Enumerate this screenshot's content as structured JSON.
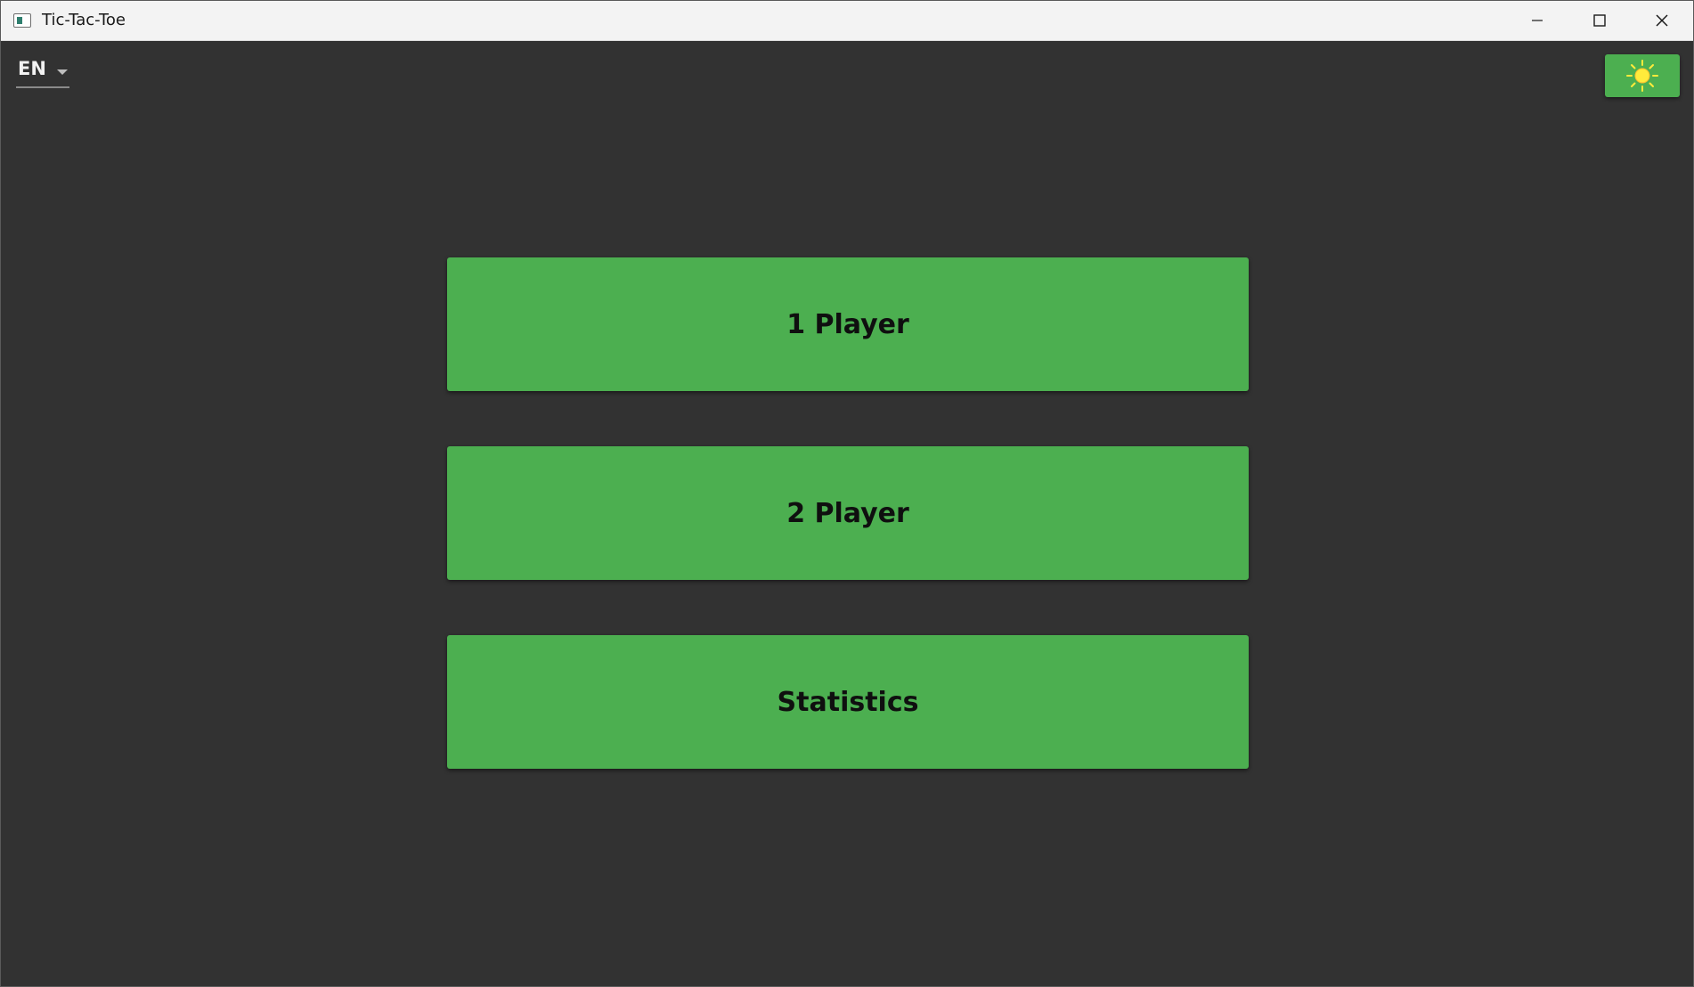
{
  "window": {
    "title": "Tic-Tac-Toe",
    "icon": "app-window-icon",
    "controls": {
      "minimize_icon": "minimize-icon",
      "maximize_icon": "maximize-icon",
      "close_icon": "close-icon"
    }
  },
  "toolbar": {
    "language": {
      "selected": "EN",
      "icon": "chevron-down-icon"
    },
    "theme_toggle": {
      "icon": "sun-icon",
      "color": "#4caf50"
    }
  },
  "menu": {
    "buttons": [
      {
        "label": "1 Player"
      },
      {
        "label": "2 Player"
      },
      {
        "label": "Statistics"
      }
    ]
  },
  "colors": {
    "background": "#323232",
    "accent": "#4caf50",
    "titlebar": "#f3f3f3"
  }
}
